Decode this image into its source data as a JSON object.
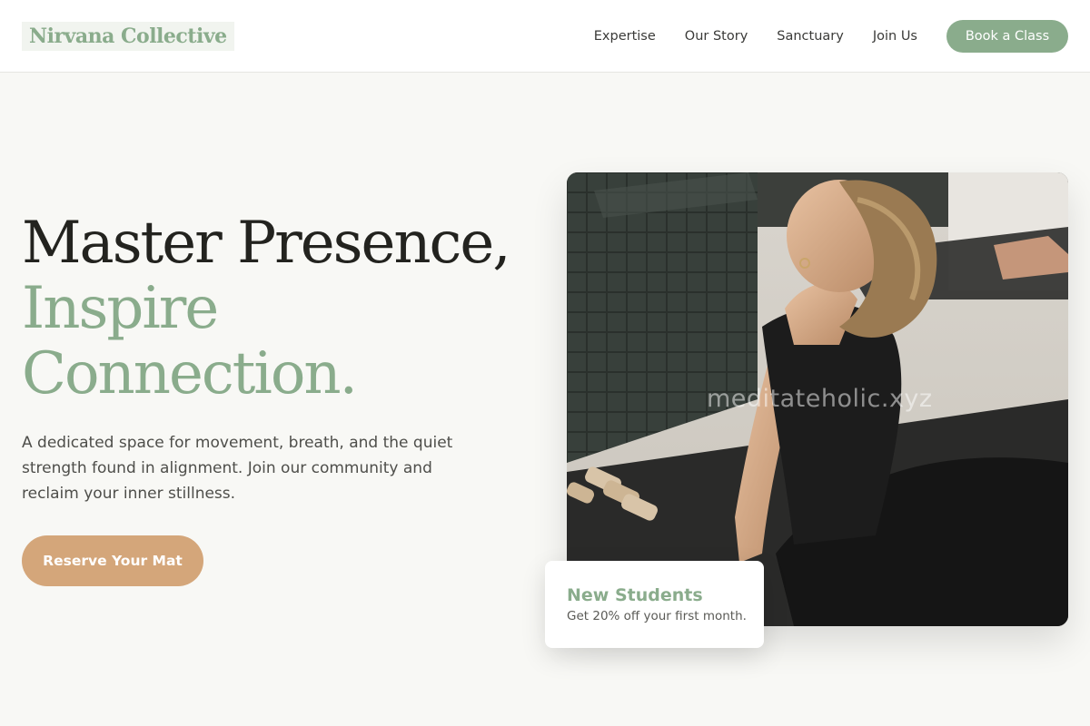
{
  "brand": {
    "name": "Nirvana Collective"
  },
  "nav": {
    "links": [
      "Expertise",
      "Our Story",
      "Sanctuary",
      "Join Us"
    ],
    "cta_label": "Book a Class"
  },
  "hero": {
    "title_line1": "Master Presence,",
    "title_line2": "Inspire",
    "title_line3": "Connection.",
    "description": "A dedicated space for movement, breath, and the quiet strength found in alignment. Join our community and reclaim your inner stillness.",
    "cta_label": "Reserve Your Mat"
  },
  "photo": {
    "subject": "woman-yoga-cobra-pose",
    "watermark": "meditateholic.xyz"
  },
  "promo": {
    "title": "New Students",
    "text": "Get 20% off your first month."
  },
  "colors": {
    "sage": "#8aac8c",
    "tan": "#d4a67a",
    "background": "#f8f8f5",
    "ink": "#23231f"
  }
}
